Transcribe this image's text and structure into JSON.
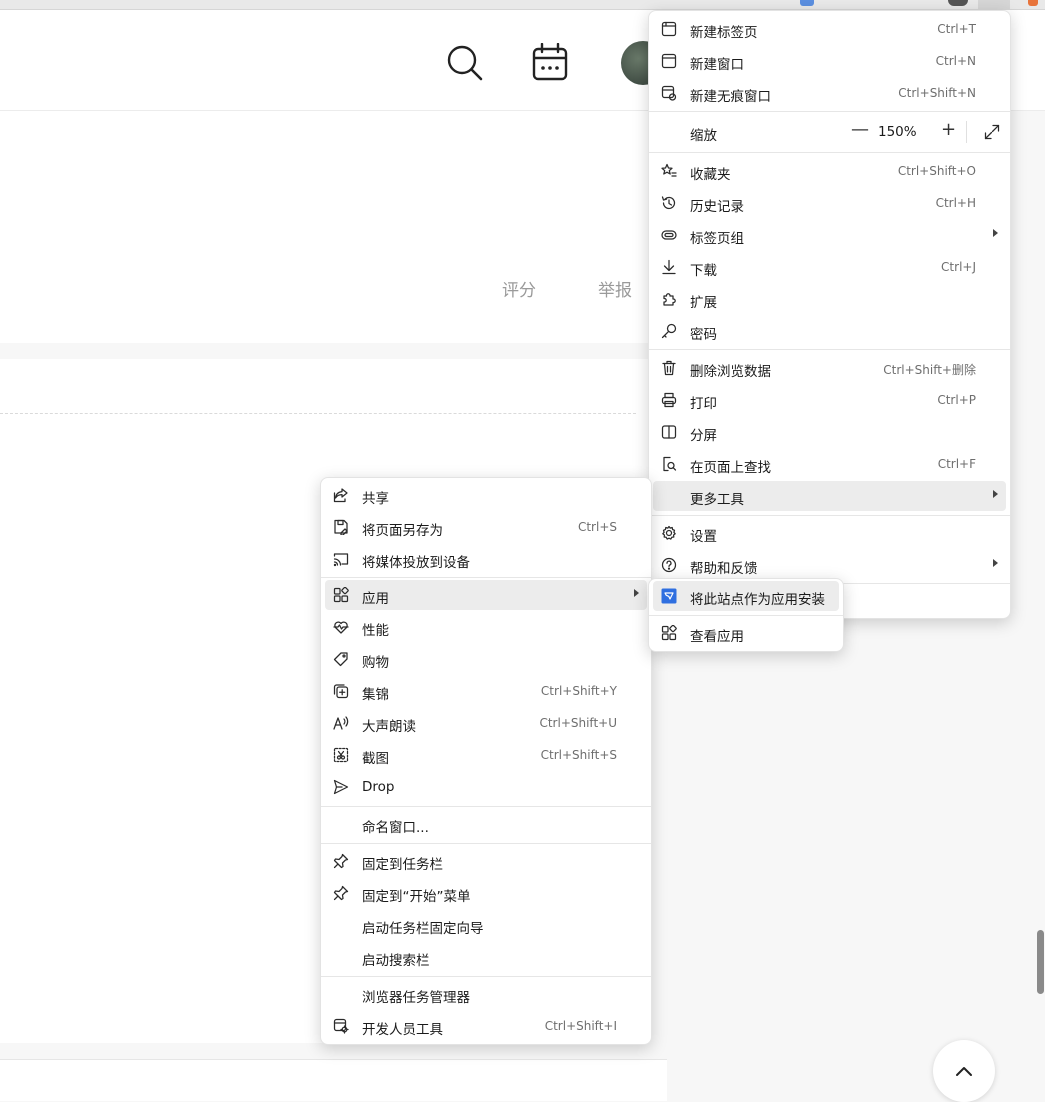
{
  "page": {
    "hero_links": [
      "评分",
      "举报"
    ]
  },
  "main_menu": {
    "items": [
      {
        "label": "新建标签页",
        "shortcut": "Ctrl+T"
      },
      {
        "label": "新建窗口",
        "shortcut": "Ctrl+N"
      },
      {
        "label": "新建无痕窗口",
        "shortcut": "Ctrl+Shift+N"
      },
      {
        "label": "收藏夹",
        "shortcut": "Ctrl+Shift+O"
      },
      {
        "label": "历史记录",
        "shortcut": "Ctrl+H"
      },
      {
        "label": "标签页组",
        "shortcut": ""
      },
      {
        "label": "下载",
        "shortcut": "Ctrl+J"
      },
      {
        "label": "扩展",
        "shortcut": ""
      },
      {
        "label": "密码",
        "shortcut": ""
      },
      {
        "label": "删除浏览数据",
        "shortcut": "Ctrl+Shift+删除"
      },
      {
        "label": "打印",
        "shortcut": "Ctrl+P"
      },
      {
        "label": "分屏",
        "shortcut": ""
      },
      {
        "label": "在页面上查找",
        "shortcut": "Ctrl+F"
      },
      {
        "label": "更多工具",
        "shortcut": ""
      },
      {
        "label": "设置",
        "shortcut": ""
      },
      {
        "label": "帮助和反馈",
        "shortcut": ""
      }
    ],
    "zoom": {
      "label": "缩放",
      "minus": "—",
      "value": "150%",
      "plus": "+"
    }
  },
  "more_tools_menu": {
    "items": [
      {
        "label": "共享",
        "shortcut": ""
      },
      {
        "label": "将页面另存为",
        "shortcut": "Ctrl+S"
      },
      {
        "label": "将媒体投放到设备",
        "shortcut": ""
      },
      {
        "label": "应用",
        "shortcut": ""
      },
      {
        "label": "性能",
        "shortcut": ""
      },
      {
        "label": "购物",
        "shortcut": ""
      },
      {
        "label": "集锦",
        "shortcut": "Ctrl+Shift+Y"
      },
      {
        "label": "大声朗读",
        "shortcut": "Ctrl+Shift+U"
      },
      {
        "label": "截图",
        "shortcut": "Ctrl+Shift+S"
      },
      {
        "label": "Drop",
        "shortcut": ""
      },
      {
        "label": "命名窗口...",
        "shortcut": ""
      },
      {
        "label": "固定到任务栏",
        "shortcut": ""
      },
      {
        "label": "固定到“开始”菜单",
        "shortcut": ""
      },
      {
        "label": "启动任务栏固定向导",
        "shortcut": ""
      },
      {
        "label": "启动搜索栏",
        "shortcut": ""
      },
      {
        "label": "浏览器任务管理器",
        "shortcut": ""
      },
      {
        "label": "开发人员工具",
        "shortcut": "Ctrl+Shift+I"
      }
    ]
  },
  "apps_submenu": {
    "items": [
      {
        "label": "将此站点作为应用安装"
      },
      {
        "label": "查看应用"
      }
    ]
  },
  "colors": {
    "accent": "#2f6fe0",
    "hover": "#ececec"
  }
}
